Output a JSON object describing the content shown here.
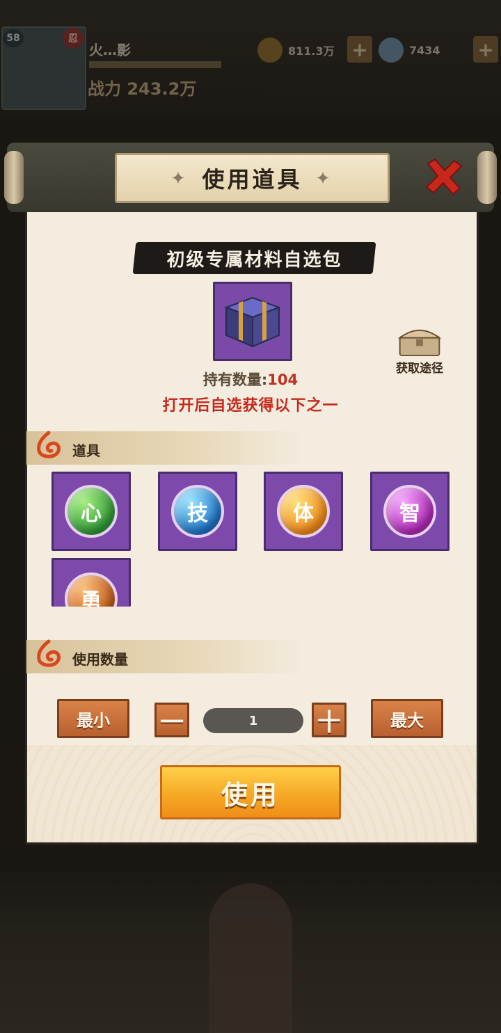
{
  "background": {
    "level": "58",
    "ninja_badge": "忍",
    "player_name": "火…影",
    "power": "战力 243.2万",
    "gold": "811.3万",
    "gems": "7434",
    "plus": "+"
  },
  "dialog": {
    "title": "使用道具",
    "item_name": "初级专属材料自选包",
    "held_label": "持有数量:",
    "held_count": "104",
    "hint": "打开后自选获得以下之一",
    "source_label": "获取途径"
  },
  "rewards_section": {
    "title": "道具",
    "items": [
      {
        "glyph": "心",
        "icon": "green-orb-icon"
      },
      {
        "glyph": "技",
        "icon": "blue-orb-icon"
      },
      {
        "glyph": "体",
        "icon": "orange-orb-icon"
      },
      {
        "glyph": "智",
        "icon": "purple-orb-icon"
      },
      {
        "glyph": "勇",
        "icon": "amber-orb-icon"
      }
    ]
  },
  "quantity_section": {
    "title": "使用数量",
    "min_label": "最小",
    "minus_label": "一",
    "value": "1",
    "plus_label": "十",
    "max_label": "最大"
  },
  "use_button": "使用",
  "colors": {
    "panel": "#f4ecdf",
    "hint_red": "#c8281c",
    "item_frame_purple": "#7d4aac",
    "button_orange": "#d9834a",
    "use_button_yellow": "#f5a623"
  }
}
